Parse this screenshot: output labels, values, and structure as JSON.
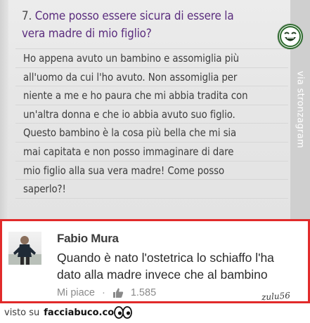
{
  "question": {
    "number": "7.",
    "title": "Come posso essere sicura di essere la vera madre di mio figlio?",
    "body_lines": [
      "Ho appena avuto un bambino e assomiglia più",
      "all'uomo da cui l'ho avuto. Non assomiglia per",
      "niente a me e ho paura che mi abbia tradita con",
      "un'altra donna e che io abbia avuto suo figlio.",
      "Questo bambino è la cosa più bella che mi sia",
      "mai capitata e non posso immaginare di dare",
      "mio figlio alla sua vera madre! Come posso",
      "saperlo?!"
    ]
  },
  "watermark": {
    "vertical": "via stronzagram",
    "badge_icon": "laughing-face-badge-icon"
  },
  "comment": {
    "author": "Fabio Mura",
    "text_lines": [
      "Quando è nato  l'ostetrica lo schiaffo l'ha",
      "dato alla madre invece che al bambino"
    ],
    "like_label": "Mi piace",
    "separator": "·",
    "like_icon": "thumbs-up-icon",
    "like_count": "1.585",
    "signature": "zulu56",
    "border_color": "#e12a2a"
  },
  "footer": {
    "prefix": "visto su",
    "site": "facciabuco.com",
    "icon": "eyes-icon"
  },
  "colors": {
    "title_purple": "#5b2d7e",
    "body_gray": "#3d3d3d"
  }
}
